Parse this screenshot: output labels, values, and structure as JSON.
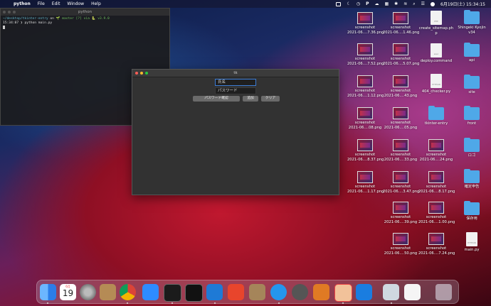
{
  "menubar": {
    "app_name": "python",
    "menus": [
      "File",
      "Edit",
      "Window",
      "Help"
    ],
    "datetime": "6月19日(土) 15:34:15",
    "status_icons": [
      "display-icon",
      "moon-icon",
      "clock-icon",
      "p-icon",
      "cloud-icon",
      "grid-icon",
      "bluetooth-icon",
      "wifi-icon",
      "search-icon",
      "control-center-icon",
      "siri-icon"
    ]
  },
  "terminal": {
    "title": "python",
    "line1_path": "~/desktop/tkinter-entry",
    "line1_on": " on ",
    "line1_branch": " master [?] via ",
    "line1_version": " v3.9.0",
    "line2_time": "15:34:07",
    "line2_cmd": " ❯ python main.py"
  },
  "tk_window": {
    "title": "tk",
    "name_field": "氏名",
    "password_field": "パスワード",
    "buttons": [
      "パスワード確認",
      "追加",
      "クリア"
    ]
  },
  "desktop": {
    "col1": [
      "screenshot\n2021-06....7.36.png",
      "screenshot\n2021-06....7.52.png",
      "screenshot\n2021-06....1.12.png",
      "screenshot\n2021-06....08.png",
      "screenshot\n2021-06....8.37.png",
      "screenshot\n2021-06....1.17.png"
    ],
    "col2": [
      "screenshot\n2021-06....1.46.png",
      "screenshot\n2021-06....5.07.png",
      "screenshot\n2021-06....43.png",
      "screenshot\n2021-06....05.png",
      "screenshot\n2021-06....33.png",
      "screenshot\n2021-06....3.47.png",
      "screenshot\n2021-06....39.png",
      "screenshot\n2021-06....50.png"
    ],
    "col3": [
      "create_sitemap.ph\np",
      "deploy.command",
      "404_checker.py",
      "tkinter-entry",
      "screenshot\n2021-06....24.png",
      "screenshot\n2021-06....8.17.png",
      "screenshot\n2021-06....1.00.png",
      "screenshot\n2021-06....7.24.png"
    ],
    "col4": [
      "Shingeki Kyojin\nv34",
      "api",
      "site",
      "front",
      "ロゴ",
      "確定申告",
      "保存用",
      "main.py"
    ],
    "doc_badges": {
      "php": "PHP",
      "exec": "exec",
      "py": "PYTHON"
    }
  },
  "dock": {
    "apps": [
      "Finder",
      "Calendar",
      "System Preferences",
      "Contacts",
      "Chrome",
      "Zoom",
      "Terminal",
      "iTerm",
      "VS Code",
      "Stocks",
      "Archive Utility",
      "Docker",
      "QuickTime",
      "Sourcetree",
      "Notes",
      "Infinity",
      "Preview",
      "Document",
      "Trash"
    ],
    "calendar_day": "19",
    "calendar_month": "6月"
  },
  "colors": {
    "accent": "#3b7bd4",
    "folder": "#4fa8e8",
    "traffic_red": "#ff5f57",
    "traffic_yellow": "#febc2e",
    "traffic_green": "#28c840"
  }
}
